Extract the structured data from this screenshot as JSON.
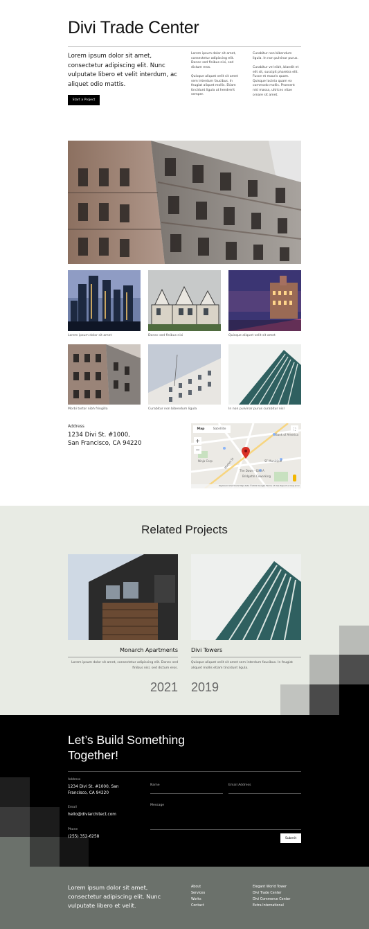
{
  "header": {
    "title": "Divi Trade Center",
    "lead": "Lorem ipsum dolor sit amet, consectetur adipiscing elit. Nunc vulputate libero et velit interdum, ac aliquet odio mattis.",
    "cta_label": "Start a Project",
    "col2_p1": "Lorem ipsum dolor sit amet, consectetur adipiscing elit. Donec sed finibus nisi, sed dictum eros.",
    "col2_p2": "Quisque aliquet velit sit amet sem interdum faucibus. In feugiat aliquet mollis. Etiam tincidunt ligula ut hendrerit semper.",
    "col3_p1": "Curabitur non bibendum ligula. In non pulvinar purus.",
    "col3_p2": "Curabitur vel nibh, blandit et elit sit, suscipit pharetra elit. Fusce et mauris quam. Quisque lacinia quam ex commodo mollis. Praesent nisl massa, ultrices vitae ornare sit amet."
  },
  "gallery": {
    "captions": [
      "Lorem ipsum dolor sit amet",
      "Donec sed finibus nisi",
      "Quisque aliquet velit sit amet",
      "Morbi tortor nibh fringilla",
      "Curabitur non bibendum ligula",
      "In non pulvinar purus curabitur nisl"
    ]
  },
  "location": {
    "label": "Address",
    "line1": "1234 Divi St. #1000,",
    "line2": "San Francisco, CA 94220",
    "map": {
      "tab_map": "Map",
      "tab_satellite": "Satellite",
      "zoom_in": "+",
      "zoom_out": "−",
      "fullscreen": "⛶",
      "footer_text": "Keyboard shortcuts  Map data ©2022 Google  Terms of Use  Report a map error",
      "labels": [
        "Bank of America",
        "The Dawn - Divi A",
        "San Francisco Municipal Transportation Agency",
        "Ninja Corporation",
        "Bridgette Coworking SF",
        "Market St"
      ]
    }
  },
  "related": {
    "title": "Related Projects",
    "projects": [
      {
        "name": "Monarch Apartments",
        "desc": "Lorem ipsum dolor sit amet, consectetur adipiscing elit. Donec sed finibus nisl, sed dictum eros.",
        "year": "2021"
      },
      {
        "name": "Divi Towers",
        "desc": "Quisque aliquet velit sit amet sem interdum faucibus. In feugiat aliquet mollis etiam tincidunt ligula.",
        "year": "2019"
      }
    ]
  },
  "contact": {
    "title": "Let’s Build Something Together!",
    "address_label": "Address",
    "address_value": "1234 Divi St. #1000, San Francisco, CA 94220",
    "email_label": "Email",
    "email_value": "hello@diviarchitect.com",
    "phone_label": "Phone",
    "phone_value": "(255) 352-6258",
    "name_placeholder": "Name",
    "email_placeholder": "Email Address",
    "message_placeholder": "Message",
    "submit_label": "Submit"
  },
  "footer": {
    "lead": "Lorem ipsum dolor sit amet, consectetur adipiscing elit. Nunc vulputate libero et velit.",
    "nav": [
      "About",
      "Services",
      "Works",
      "Contact"
    ],
    "projects": [
      "Elegant World Tower",
      "Divi Trade Center",
      "Divi Commerce Center",
      "Extra International"
    ]
  },
  "colors": {
    "accent": "#000000",
    "related_bg": "#e8ebe4",
    "footer_grey": "#6b716b",
    "map_pin": "#d93025"
  }
}
